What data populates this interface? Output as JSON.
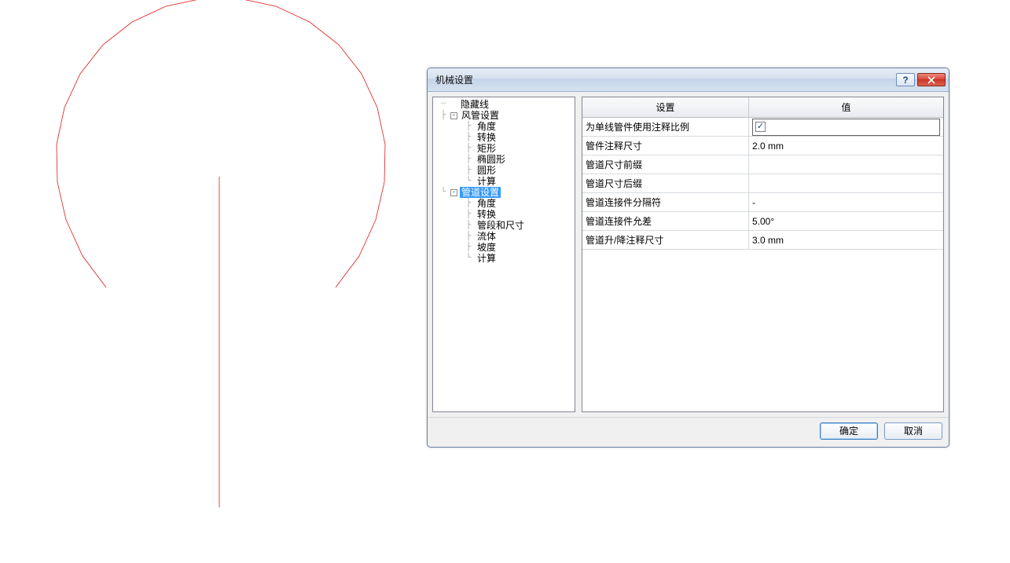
{
  "dialog": {
    "title": "机械设置",
    "help_symbol": "?",
    "ok_label": "确定",
    "cancel_label": "取消"
  },
  "tree": {
    "hidden_line": "隐藏线",
    "duct_settings": "风管设置",
    "duct_children": {
      "angle": "角度",
      "convert": "转换",
      "rect": "矩形",
      "ellipse": "椭圆形",
      "circle": "圆形",
      "calc": "计算"
    },
    "pipe_settings": "管道设置",
    "pipe_children": {
      "angle": "角度",
      "convert": "转换",
      "segment_size": "管段和尺寸",
      "fluid": "流体",
      "slope": "坡度",
      "calc": "计算"
    },
    "toggle_minus": "-"
  },
  "table": {
    "header_setting": "设置",
    "header_value": "值",
    "rows": [
      {
        "setting": "为单线管件使用注释比例",
        "value_type": "checkbox",
        "checked": true,
        "value": ""
      },
      {
        "setting": "管件注释尺寸",
        "value_type": "text",
        "value": "2.0 mm"
      },
      {
        "setting": "管道尺寸前缀",
        "value_type": "text",
        "value": ""
      },
      {
        "setting": "管道尺寸后缀",
        "value_type": "text",
        "value": ""
      },
      {
        "setting": "管道连接件分隔符",
        "value_type": "text",
        "value": "-"
      },
      {
        "setting": "管道连接件允差",
        "value_type": "text",
        "value": "5.00°"
      },
      {
        "setting": "管道升/降注释尺寸",
        "value_type": "text",
        "value": "3.0 mm"
      }
    ]
  }
}
